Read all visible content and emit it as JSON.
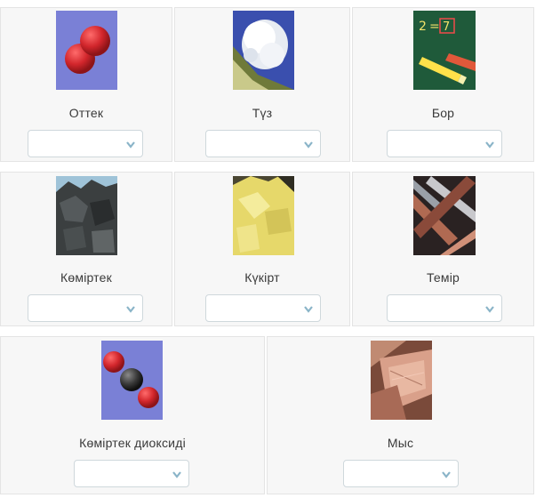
{
  "items": [
    {
      "label": "Оттек",
      "selected": "",
      "icon": "oxygen-molecule-icon"
    },
    {
      "label": "Түз",
      "selected": "",
      "icon": "salt-icon"
    },
    {
      "label": "Бор",
      "selected": "",
      "icon": "chalk-icon"
    },
    {
      "label": "Көміртек",
      "selected": "",
      "icon": "coal-icon"
    },
    {
      "label": "Күкірт",
      "selected": "",
      "icon": "sulfur-icon"
    },
    {
      "label": "Темір",
      "selected": "",
      "icon": "iron-icon"
    },
    {
      "label": "Көміртек диоксиді",
      "selected": "",
      "icon": "carbon-dioxide-molecule-icon"
    },
    {
      "label": "Мыс",
      "selected": "",
      "icon": "copper-icon"
    }
  ],
  "colors": {
    "card_bg": "#f7f7f7",
    "card_border": "#e4e4e4",
    "chevron": "#8ab4c8",
    "molecule_bg": "#7a80d6",
    "oxygen_red": "#d2262c",
    "carbon_gray": "#3a3a3a"
  }
}
